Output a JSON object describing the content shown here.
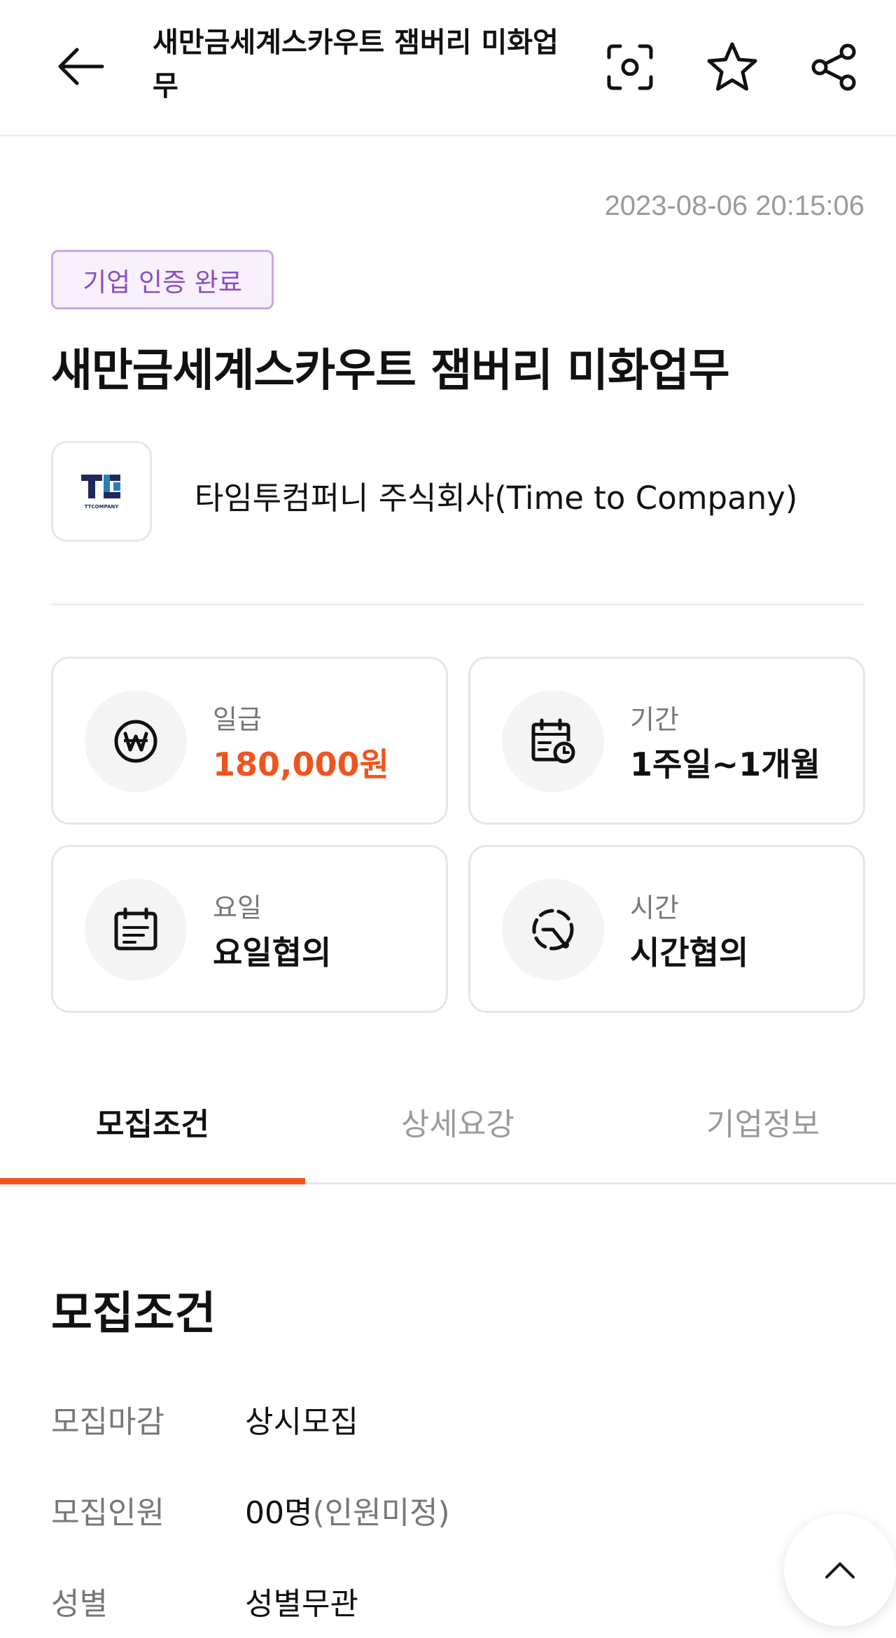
{
  "header": {
    "title": "새만금세계스카우트 잼버리 미화업무"
  },
  "post": {
    "timestamp": "2023-08-06 20:15:06",
    "badge": "기업 인증 완료",
    "title": "새만금세계스카우트 잼버리 미화업무"
  },
  "company": {
    "name": "타임투컴퍼니 주식회사(Time to Company)",
    "logo_text": "TTCOMPANY"
  },
  "cards": {
    "wage": {
      "label": "일급",
      "value": "180,000원",
      "icon": "won-icon"
    },
    "period": {
      "label": "기간",
      "value": "1주일~1개월",
      "icon": "calendar-clock-icon"
    },
    "days": {
      "label": "요일",
      "value": "요일협의",
      "icon": "calendar-icon"
    },
    "hours": {
      "label": "시간",
      "value": "시간협의",
      "icon": "clock-dashed-icon"
    }
  },
  "tabs": [
    {
      "label": "모집조건",
      "active": true
    },
    {
      "label": "상세요강",
      "active": false
    },
    {
      "label": "기업정보",
      "active": false
    }
  ],
  "section": {
    "title": "모집조건",
    "rows": [
      {
        "label": "모집마감",
        "value": "상시모집",
        "note": ""
      },
      {
        "label": "모집인원",
        "value": "00명",
        "note": "(인원미정)"
      },
      {
        "label": "성별",
        "value": "성별무관",
        "note": ""
      }
    ]
  },
  "colors": {
    "accent": "#f0541e",
    "badge_text": "#8a4fbf",
    "badge_border": "#c9a8e6"
  }
}
